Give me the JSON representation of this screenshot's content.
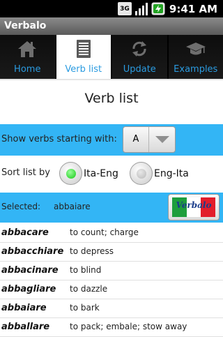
{
  "status_bar": {
    "network": "3G",
    "time": "9:41 AM"
  },
  "app": {
    "title": "Verbalo"
  },
  "tabs": [
    {
      "label": "Home",
      "icon": "home-icon",
      "active": false
    },
    {
      "label": "Verb list",
      "icon": "list-icon",
      "active": true
    },
    {
      "label": "Update",
      "icon": "refresh-icon",
      "active": false
    },
    {
      "label": "Examples",
      "icon": "graduation-cap-icon",
      "active": false
    }
  ],
  "page": {
    "title": "Verb list"
  },
  "filter": {
    "label": "Show verbs starting with:",
    "letter": "A"
  },
  "sort": {
    "label": "Sort list by",
    "options": [
      {
        "label": "Ita-Eng",
        "selected": true
      },
      {
        "label": "Eng-Ita",
        "selected": false
      }
    ]
  },
  "selection": {
    "label": "Selected:",
    "value": "abbaiare",
    "logo_text": "Verbalo"
  },
  "verbs": [
    {
      "word": "abbacare",
      "meaning": "to count; charge"
    },
    {
      "word": "abbacchiare",
      "meaning": "to depress"
    },
    {
      "word": "abbacinare",
      "meaning": "to blind"
    },
    {
      "word": "abbagliare",
      "meaning": "to dazzle"
    },
    {
      "word": "abbaiare",
      "meaning": "to bark"
    },
    {
      "word": "abballare",
      "meaning": "to pack; embale; stow away"
    }
  ],
  "colors": {
    "accent": "#33b5f5",
    "tab_label": "#2b9be0",
    "radio_on": "#22dd22"
  }
}
